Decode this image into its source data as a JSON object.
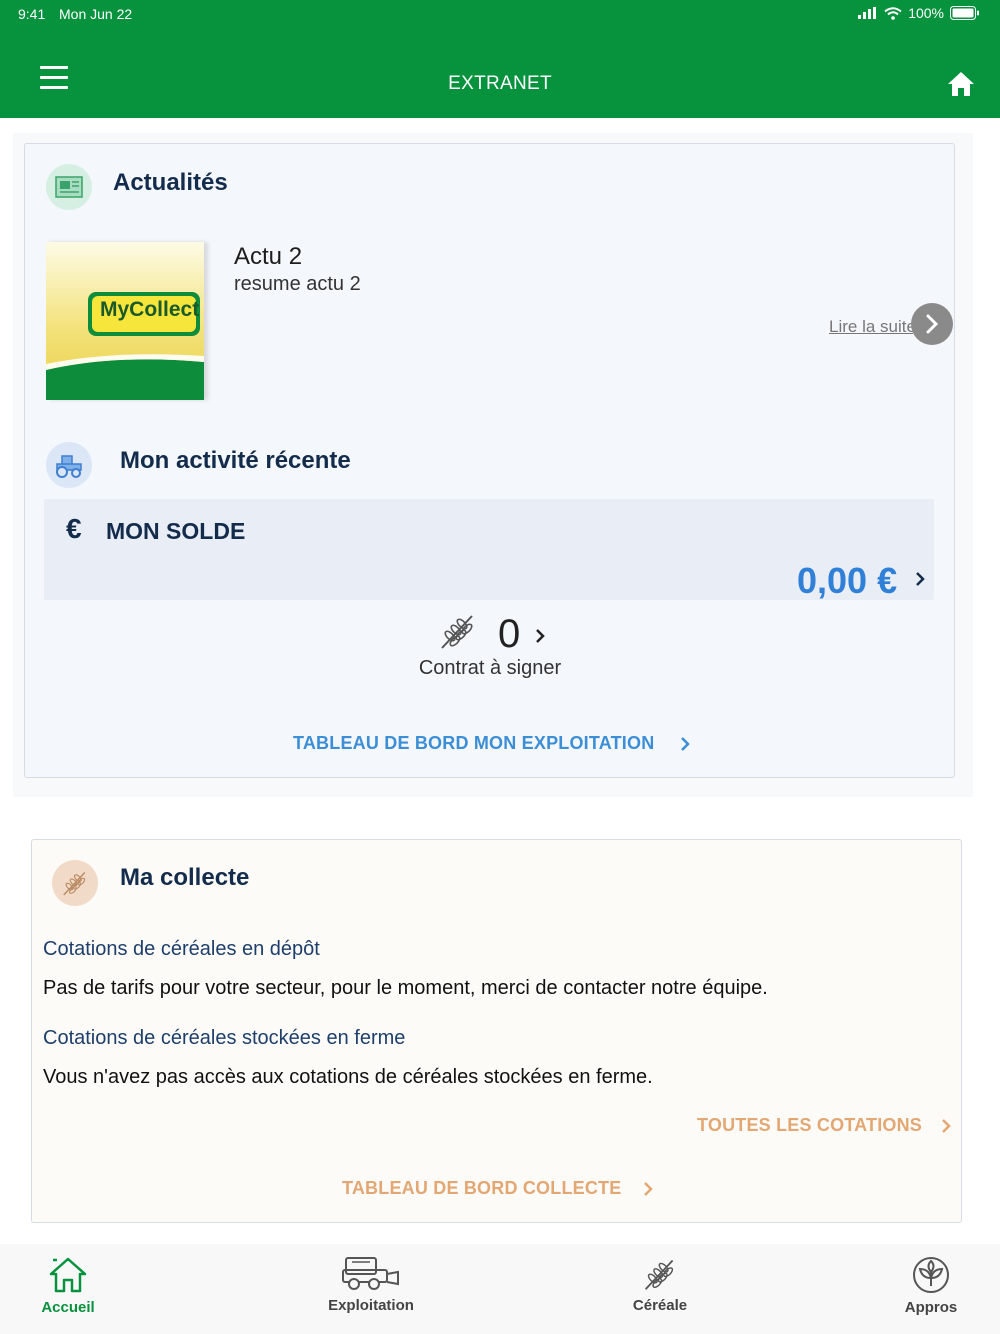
{
  "status_bar": {
    "time": "9:41",
    "date": "Mon Jun 22",
    "battery": "100%"
  },
  "header": {
    "title": "EXTRANET",
    "menu_icon": "hamburger-icon",
    "home_icon": "home-icon"
  },
  "news": {
    "section_title": "Actualités",
    "item_title": "Actu 2",
    "item_summary": "resume actu 2",
    "logo_text": "MyCollect",
    "read_more": "Lire la suite"
  },
  "activity": {
    "section_title": "Mon activité récente",
    "balance_symbol": "€",
    "balance_label": "MON SOLDE",
    "balance_value": "0,00 €",
    "contracts_count": "0",
    "contracts_label": "Contrat à signer",
    "dashboard_link": "TABLEAU DE BORD MON EXPLOITATION"
  },
  "collecte": {
    "section_title": "Ma collecte",
    "deposit_heading": "Cotations de céréales en dépôt",
    "deposit_text": "Pas de tarifs pour votre secteur, pour le moment, merci de contacter notre équipe.",
    "farm_heading": "Cotations de céréales stockées en ferme",
    "farm_text": "Vous n'avez pas accès aux cotations de céréales stockées en ferme.",
    "all_quotes_link": "TOUTES LES COTATIONS",
    "dashboard_link": "TABLEAU DE BORD COLLECTE"
  },
  "tabs": [
    {
      "label": "Accueil",
      "icon": "home-icon",
      "active": true
    },
    {
      "label": "Exploitation",
      "icon": "harvester-icon",
      "active": false
    },
    {
      "label": "Céréale",
      "icon": "wheat-icon",
      "active": false
    },
    {
      "label": "Appros",
      "icon": "plant-icon",
      "active": false
    }
  ],
  "colors": {
    "brand": "#07923e",
    "accent_blue": "#2f80d6",
    "accent_orange": "#e2a772",
    "dark_navy": "#142c4c"
  }
}
